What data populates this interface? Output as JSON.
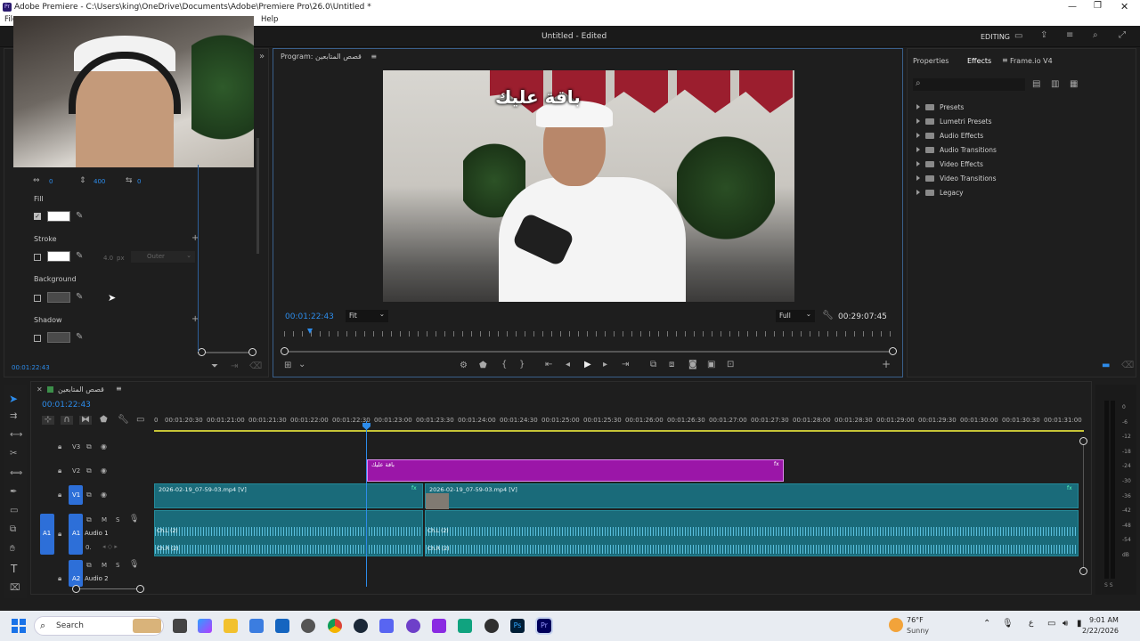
{
  "window": {
    "title": "Adobe Premiere - C:\\Users\\king\\OneDrive\\Documents\\Adobe\\Premiere Pro\\26.0\\Untitled *",
    "menu_left": "File",
    "menu_right": "Help"
  },
  "app_header": {
    "project_title": "Untitled",
    "project_status": "- Edited",
    "workspace": "EDITING"
  },
  "essential_graphics": {
    "tracking_value": "0",
    "leading_value": "400",
    "kerning_value": "0",
    "fill_label": "Fill",
    "stroke_label": "Stroke",
    "stroke_width": "4.0",
    "stroke_unit": "px",
    "stroke_type": "Outer",
    "background_label": "Background",
    "shadow_label": "Shadow",
    "timecode": "00:01:22:43"
  },
  "program_monitor": {
    "title": "Program: قصص المتابعين",
    "timecode": "00:01:22:43",
    "fit": "Fit",
    "quality": "Full",
    "duration": "00:29:07:45",
    "overlay_text": "باقة عليك"
  },
  "right_panel": {
    "tabs": [
      "Properties",
      "Effects",
      "Frame.io V4"
    ],
    "active_tab": "Effects",
    "search_placeholder": "",
    "tree": [
      "Presets",
      "Lumetri Presets",
      "Audio Effects",
      "Audio Transitions",
      "Video Effects",
      "Video Transitions",
      "Legacy"
    ]
  },
  "timeline": {
    "sequence_name": "قصص المتابعين",
    "timecode": "00:01:22:43",
    "ruler": [
      "0",
      "00:01:20:30",
      "00:01:21:00",
      "00:01:21:30",
      "00:01:22:00",
      "00:01:22:30",
      "00:01:23:00",
      "00:01:23:30",
      "00:01:24:00",
      "00:01:24:30",
      "00:01:25:00",
      "00:01:25:30",
      "00:01:26:00",
      "00:01:26:30",
      "00:01:27:00",
      "00:01:27:30",
      "00:01:28:00",
      "00:01:28:30",
      "00:01:29:00",
      "00:01:29:30",
      "00:01:30:00",
      "00:01:30:30",
      "00:01:31:00"
    ],
    "tracks": {
      "v3": "V3",
      "v2": "V2",
      "v1": "V1",
      "a1_src": "A1",
      "a1": "A1",
      "a1_name": "Audio 1",
      "a2": "A2",
      "a2_name": "Audio 2"
    },
    "graphic_clip": "باقة عليك",
    "video_clip_1": "2026-02-19_07-59-03.mp4 [V]",
    "video_clip_2": "2026-02-19_07-59-03.mp4 [V]",
    "audio_ch_l": "Ch.L (2)",
    "audio_ch_r": "Ch.R (2)",
    "audio_ch_l_2": "Ch.L (2)",
    "audio_ch_r_2": "Ch.R (2)",
    "meter_scale": [
      "0",
      "-6",
      "-12",
      "-18",
      "-24",
      "-30",
      "-36",
      "-42",
      "-48",
      "-54",
      "dB"
    ],
    "meter_bottom": "S S"
  },
  "taskbar": {
    "search": "Search",
    "weather_temp": "76°F",
    "weather_cond": "Sunny",
    "time": "9:01 AM",
    "date": "2/22/2026"
  },
  "colors": {
    "accent_blue": "#2d8ceb",
    "clip_teal": "#1a6b7a",
    "graphic_purple": "#9b16a8"
  }
}
